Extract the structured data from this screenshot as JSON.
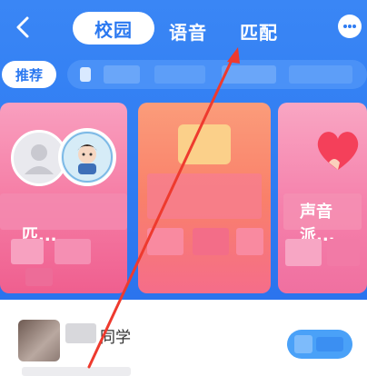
{
  "topbar": {
    "back_icon": "chevron-left-icon",
    "tabs": [
      {
        "label": "校园",
        "active": true
      },
      {
        "label": "语音",
        "active": false
      },
      {
        "label": "匹配",
        "active": false
      }
    ],
    "chat_icon": "chat-bubble-icon"
  },
  "filter": {
    "recommend_label": "推荐"
  },
  "cards": [
    {
      "title": "匹..."
    },
    {
      "title": ""
    },
    {
      "title": "声音派..."
    }
  ],
  "list": {
    "item_name": "同学"
  },
  "colors": {
    "accent": "#2f7cf2",
    "tab_active_text": "#2a78f0",
    "card_pink": "#f57aa3",
    "card_orange": "#f9806a"
  }
}
